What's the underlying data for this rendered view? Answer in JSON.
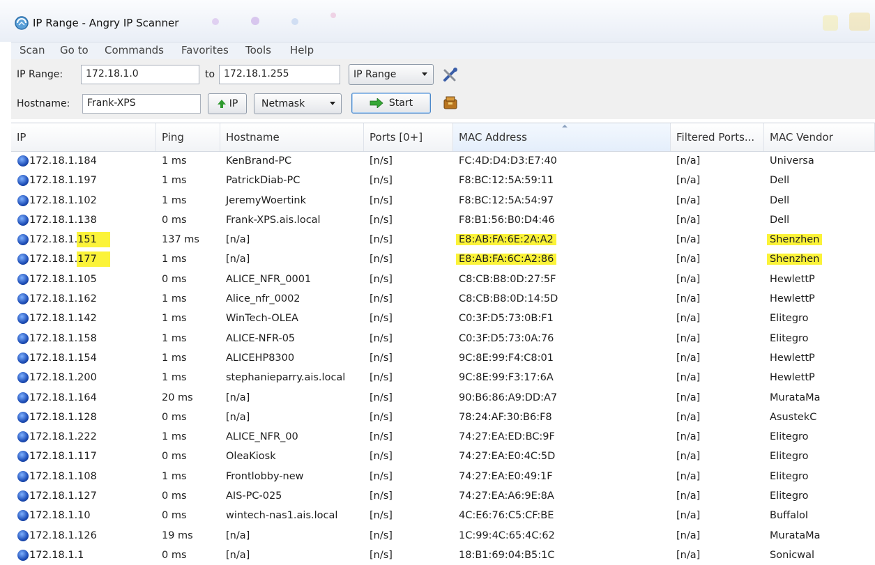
{
  "window": {
    "title": "IP Range - Angry IP Scanner"
  },
  "menu": [
    "Scan",
    "Go to",
    "Commands",
    "Favorites",
    "Tools",
    "Help"
  ],
  "toolbar": {
    "ip_range_label": "IP Range:",
    "ip_from": "172.18.1.0",
    "to_label": "to",
    "ip_to": "172.18.1.255",
    "feeder_select": "IP Range",
    "hostname_label": "Hostname:",
    "hostname": "Frank-XPS",
    "ip_button": "IP",
    "netmask_select": "Netmask",
    "start_button": "Start"
  },
  "table": {
    "columns": [
      "IP",
      "Ping",
      "Hostname",
      "Ports [0+]",
      "MAC Address",
      "Filtered Ports...",
      "MAC Vendor"
    ],
    "rows": [
      [
        "172.18.1.184",
        "1 ms",
        "KenBrand-PC",
        "[n/s]",
        "FC:4D:D4:D3:E7:40",
        "[n/a]",
        "Universa"
      ],
      [
        "172.18.1.197",
        "1 ms",
        "PatrickDiab-PC",
        "[n/s]",
        "F8:BC:12:5A:59:11",
        "[n/a]",
        "Dell"
      ],
      [
        "172.18.1.102",
        "1 ms",
        "JeremyWoertink",
        "[n/s]",
        "F8:BC:12:5A:54:97",
        "[n/a]",
        "Dell"
      ],
      [
        "172.18.1.138",
        "0 ms",
        "Frank-XPS.ais.local",
        "[n/s]",
        "F8:B1:56:B0:D4:46",
        "[n/a]",
        "Dell"
      ],
      [
        "172.18.1.151",
        "137 ms",
        "[n/a]",
        "[n/s]",
        "E8:AB:FA:6E:2A:A2",
        "[n/a]",
        "Shenzhen"
      ],
      [
        "172.18.1.177",
        "1 ms",
        "[n/a]",
        "[n/s]",
        "E8:AB:FA:6C:A2:86",
        "[n/a]",
        "Shenzhen"
      ],
      [
        "172.18.1.105",
        "0 ms",
        "ALICE_NFR_0001",
        "[n/s]",
        "C8:CB:B8:0D:27:5F",
        "[n/a]",
        "HewlettP"
      ],
      [
        "172.18.1.162",
        "1 ms",
        "Alice_nfr_0002",
        "[n/s]",
        "C8:CB:B8:0D:14:5D",
        "[n/a]",
        "HewlettP"
      ],
      [
        "172.18.1.142",
        "1 ms",
        "WinTech-OLEA",
        "[n/s]",
        "C0:3F:D5:73:0B:F1",
        "[n/a]",
        "Elitegro"
      ],
      [
        "172.18.1.158",
        "1 ms",
        "ALICE-NFR-05",
        "[n/s]",
        "C0:3F:D5:73:0A:76",
        "[n/a]",
        "Elitegro"
      ],
      [
        "172.18.1.154",
        "1 ms",
        "ALICEHP8300",
        "[n/s]",
        "9C:8E:99:F4:C8:01",
        "[n/a]",
        "HewlettP"
      ],
      [
        "172.18.1.200",
        "1 ms",
        "stephanieparry.ais.local",
        "[n/s]",
        "9C:8E:99:F3:17:6A",
        "[n/a]",
        "HewlettP"
      ],
      [
        "172.18.1.164",
        "20 ms",
        "[n/a]",
        "[n/s]",
        "90:B6:86:A9:DD:A7",
        "[n/a]",
        "MurataMa"
      ],
      [
        "172.18.1.128",
        "0 ms",
        "[n/a]",
        "[n/s]",
        "78:24:AF:30:B6:F8",
        "[n/a]",
        "AsustekC"
      ],
      [
        "172.18.1.222",
        "1 ms",
        "ALICE_NFR_00",
        "[n/s]",
        "74:27:EA:ED:BC:9F",
        "[n/a]",
        "Elitegro"
      ],
      [
        "172.18.1.117",
        "0 ms",
        "OleaKiosk",
        "[n/s]",
        "74:27:EA:E0:4C:5D",
        "[n/a]",
        "Elitegro"
      ],
      [
        "172.18.1.108",
        "1 ms",
        "Frontlobby-new",
        "[n/s]",
        "74:27:EA:E0:49:1F",
        "[n/a]",
        "Elitegro"
      ],
      [
        "172.18.1.127",
        "0 ms",
        "AIS-PC-025",
        "[n/s]",
        "74:27:EA:A6:9E:8A",
        "[n/a]",
        "Elitegro"
      ],
      [
        "172.18.1.10",
        "0 ms",
        "wintech-nas1.ais.local",
        "[n/s]",
        "4C:E6:76:C5:CF:BE",
        "[n/a]",
        "BuffaloI"
      ],
      [
        "172.18.1.126",
        "19 ms",
        "[n/a]",
        "[n/s]",
        "1C:99:4C:65:4C:62",
        "[n/a]",
        "MurataMa"
      ],
      [
        "172.18.1.1",
        "0 ms",
        "[n/a]",
        "[n/s]",
        "18:B1:69:04:B5:1C",
        "[n/a]",
        "Sonicwal"
      ]
    ]
  },
  "colors": {
    "highlight": "#fbf339",
    "accent": "#1f4fb8"
  }
}
